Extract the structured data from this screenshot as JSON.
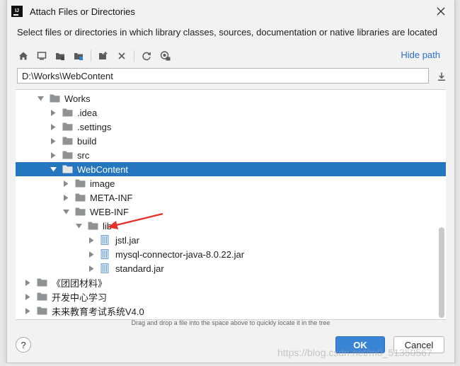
{
  "window": {
    "title": "Attach Files or Directories"
  },
  "description": "Select files or directories in which library classes, sources, documentation or native libraries are located",
  "toolbar": {
    "hide_path_label": "Hide path"
  },
  "path": {
    "value": "D:\\Works\\WebContent"
  },
  "tree": {
    "rows": [
      {
        "label": "Works",
        "depth": 1,
        "expanded": true,
        "type": "folder"
      },
      {
        "label": ".idea",
        "depth": 2,
        "expanded": false,
        "type": "folder"
      },
      {
        "label": ".settings",
        "depth": 2,
        "expanded": false,
        "type": "folder"
      },
      {
        "label": "build",
        "depth": 2,
        "expanded": false,
        "type": "folder"
      },
      {
        "label": "src",
        "depth": 2,
        "expanded": false,
        "type": "folder"
      },
      {
        "label": "WebContent",
        "depth": 2,
        "expanded": true,
        "type": "folder",
        "selected": true
      },
      {
        "label": "image",
        "depth": 3,
        "expanded": false,
        "type": "folder"
      },
      {
        "label": "META-INF",
        "depth": 3,
        "expanded": false,
        "type": "folder"
      },
      {
        "label": "WEB-INF",
        "depth": 3,
        "expanded": true,
        "type": "folder"
      },
      {
        "label": "lib",
        "depth": 4,
        "expanded": true,
        "type": "folder"
      },
      {
        "label": "jstl.jar",
        "depth": 5,
        "expanded": false,
        "type": "jar"
      },
      {
        "label": "mysql-connector-java-8.0.22.jar",
        "depth": 5,
        "expanded": false,
        "type": "jar"
      },
      {
        "label": "standard.jar",
        "depth": 5,
        "expanded": false,
        "type": "jar"
      },
      {
        "label": "《团团材料》",
        "depth": 0,
        "expanded": false,
        "type": "folder"
      },
      {
        "label": "开发中心学习",
        "depth": 0,
        "expanded": false,
        "type": "folder"
      },
      {
        "label": "未来教育考试系统V4.0",
        "depth": 0,
        "expanded": false,
        "type": "folder"
      }
    ]
  },
  "hint": "Drag and drop a file into the space above to quickly locate it in the tree",
  "footer": {
    "help_label": "?",
    "ok_label": "OK",
    "cancel_label": "Cancel"
  },
  "watermark": "https://blog.csdn.net/m0_51350567",
  "colors": {
    "selection": "#2675bf",
    "accent": "#3a84d6",
    "link": "#2a6ec8",
    "annotation_arrow": "#e8302a"
  }
}
